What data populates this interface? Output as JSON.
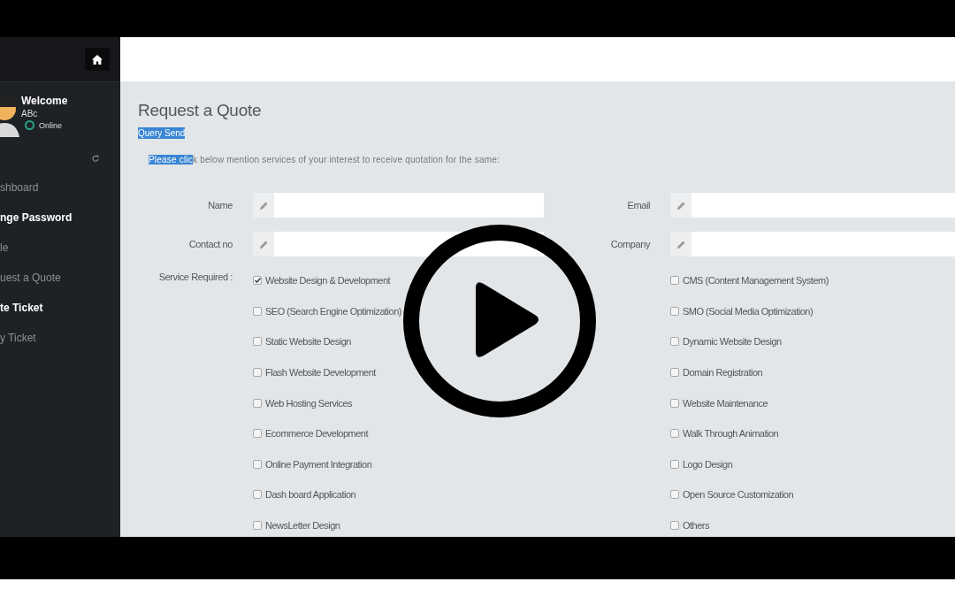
{
  "sidebar": {
    "welcome": "Welcome",
    "user": "ABc",
    "status": {
      "label": "Online",
      "online": true
    },
    "items": [
      {
        "label": "shboard",
        "active": false
      },
      {
        "label": "nge Password",
        "active": true
      },
      {
        "label": "le",
        "active": false
      },
      {
        "label": "uest a Quote",
        "active": false
      },
      {
        "label": "te Ticket",
        "active": true
      },
      {
        "label": "y Ticket",
        "active": false
      }
    ]
  },
  "page": {
    "title": "Request a Quote",
    "query_link": {
      "label": "Query Send",
      "highlighted": true
    },
    "intro": [
      {
        "text": "Please clic",
        "highlighted": true
      },
      {
        "text": "k below mention services of your interest to receive quotation for the same:",
        "highlighted": false
      }
    ]
  },
  "form": {
    "services_label": "Service Required :",
    "columns": [
      {
        "fields": [
          {
            "label": "Name"
          },
          {
            "label": "Contact no"
          }
        ],
        "services": [
          {
            "label": "Website Design & Development",
            "checked": true
          },
          {
            "label": "SEO (Search Engine Optimization)",
            "checked": false
          },
          {
            "label": "Static Website Design",
            "checked": false
          },
          {
            "label": "Flash Website Development",
            "checked": false
          },
          {
            "label": "Web Hosting Services",
            "checked": false
          },
          {
            "label": "Ecommerce Development",
            "checked": false
          },
          {
            "label": "Online Payment Integration",
            "checked": false
          },
          {
            "label": "Dash board Application",
            "checked": false
          },
          {
            "label": "NewsLetter Design",
            "checked": false
          }
        ]
      },
      {
        "fields": [
          {
            "label": "Email"
          },
          {
            "label": "Company"
          }
        ],
        "services": [
          {
            "label": "CMS (Content Management System)",
            "checked": false
          },
          {
            "label": "SMO (Social Media Optimization)",
            "checked": false
          },
          {
            "label": "Dynamic Website Design",
            "checked": false
          },
          {
            "label": "Domain Registration",
            "checked": false
          },
          {
            "label": "Website Maintenance",
            "checked": false
          },
          {
            "label": "Walk Through Animation",
            "checked": false
          },
          {
            "label": "Logo Design",
            "checked": false
          },
          {
            "label": "Open Source Customization",
            "checked": false
          },
          {
            "label": "Others",
            "checked": false
          }
        ]
      }
    ]
  },
  "player": {
    "paused": true
  }
}
